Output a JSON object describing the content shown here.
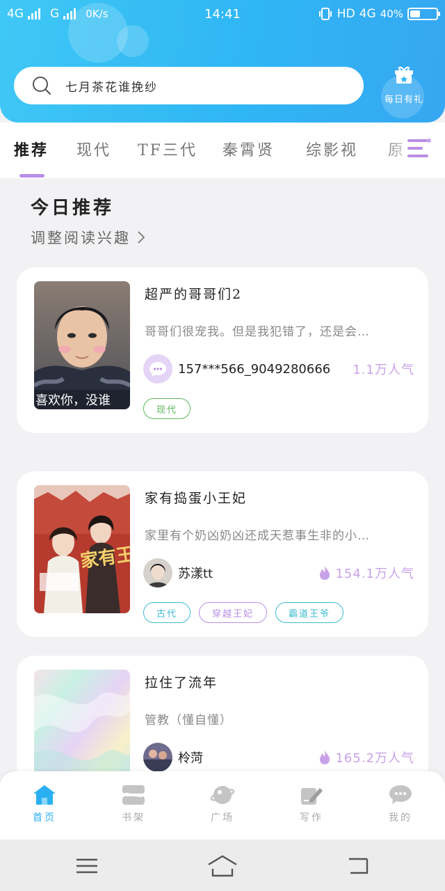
{
  "status_bar": {
    "network_1": "4G",
    "network_2": "G",
    "speed": "0K/s",
    "time": "14:41",
    "hd": "HD",
    "network_3": "4G",
    "battery_percent": "40%",
    "battery_level": 0.4
  },
  "search": {
    "placeholder": "七月茶花谁挽纱"
  },
  "daily_gift": {
    "label": "每日有礼"
  },
  "tabs": [
    {
      "label": "推荐",
      "active": true
    },
    {
      "label": "现代",
      "active": false
    },
    {
      "label": "TF三代",
      "active": false
    },
    {
      "label": "秦霄贤",
      "active": false
    },
    {
      "label": "综影视",
      "active": false
    },
    {
      "label": "原",
      "active": false
    }
  ],
  "section": {
    "title": "今日推荐",
    "adjust_label": "调整阅读兴趣"
  },
  "books": [
    {
      "title": "超严的哥哥们2",
      "description": "哥哥们很宠我。但是我犯错了，还是会…",
      "author": "157***566_9049280666",
      "popularity": "1.1万人气",
      "cover_caption": "喜欢你，没谁",
      "tags": [
        {
          "label": "现代",
          "color": "#5cb85c"
        }
      ]
    },
    {
      "title": "家有捣蛋小王妃",
      "description": "家里有个奶凶奶凶还成天惹事生非的小…",
      "author": "苏漾tt",
      "popularity": "154.1万人气",
      "cover_caption": "家有王妃",
      "tags": [
        {
          "label": "古代",
          "color": "#3bbbd0"
        },
        {
          "label": "穿越王妃",
          "color": "#b98ee6"
        },
        {
          "label": "霸道王爷",
          "color": "#3bbbd0"
        }
      ]
    },
    {
      "title": "拉住了流年",
      "description": "管教（懂自懂）",
      "author": "柃菏",
      "popularity": "165.2万人气",
      "tags": []
    }
  ],
  "bottom_nav": [
    {
      "label": "首页",
      "icon": "home-icon",
      "active": true
    },
    {
      "label": "书架",
      "icon": "bookshelf-icon",
      "active": false
    },
    {
      "label": "广场",
      "icon": "planet-icon",
      "active": false
    },
    {
      "label": "写作",
      "icon": "pen-icon",
      "active": false
    },
    {
      "label": "我的",
      "icon": "chat-bubble-icon",
      "active": false
    }
  ],
  "colors": {
    "header_blue": "#2fb6f4",
    "accent_purple": "#b98ee6",
    "popularity": "#c8a2e8",
    "nav_active": "#2ab0f2"
  }
}
